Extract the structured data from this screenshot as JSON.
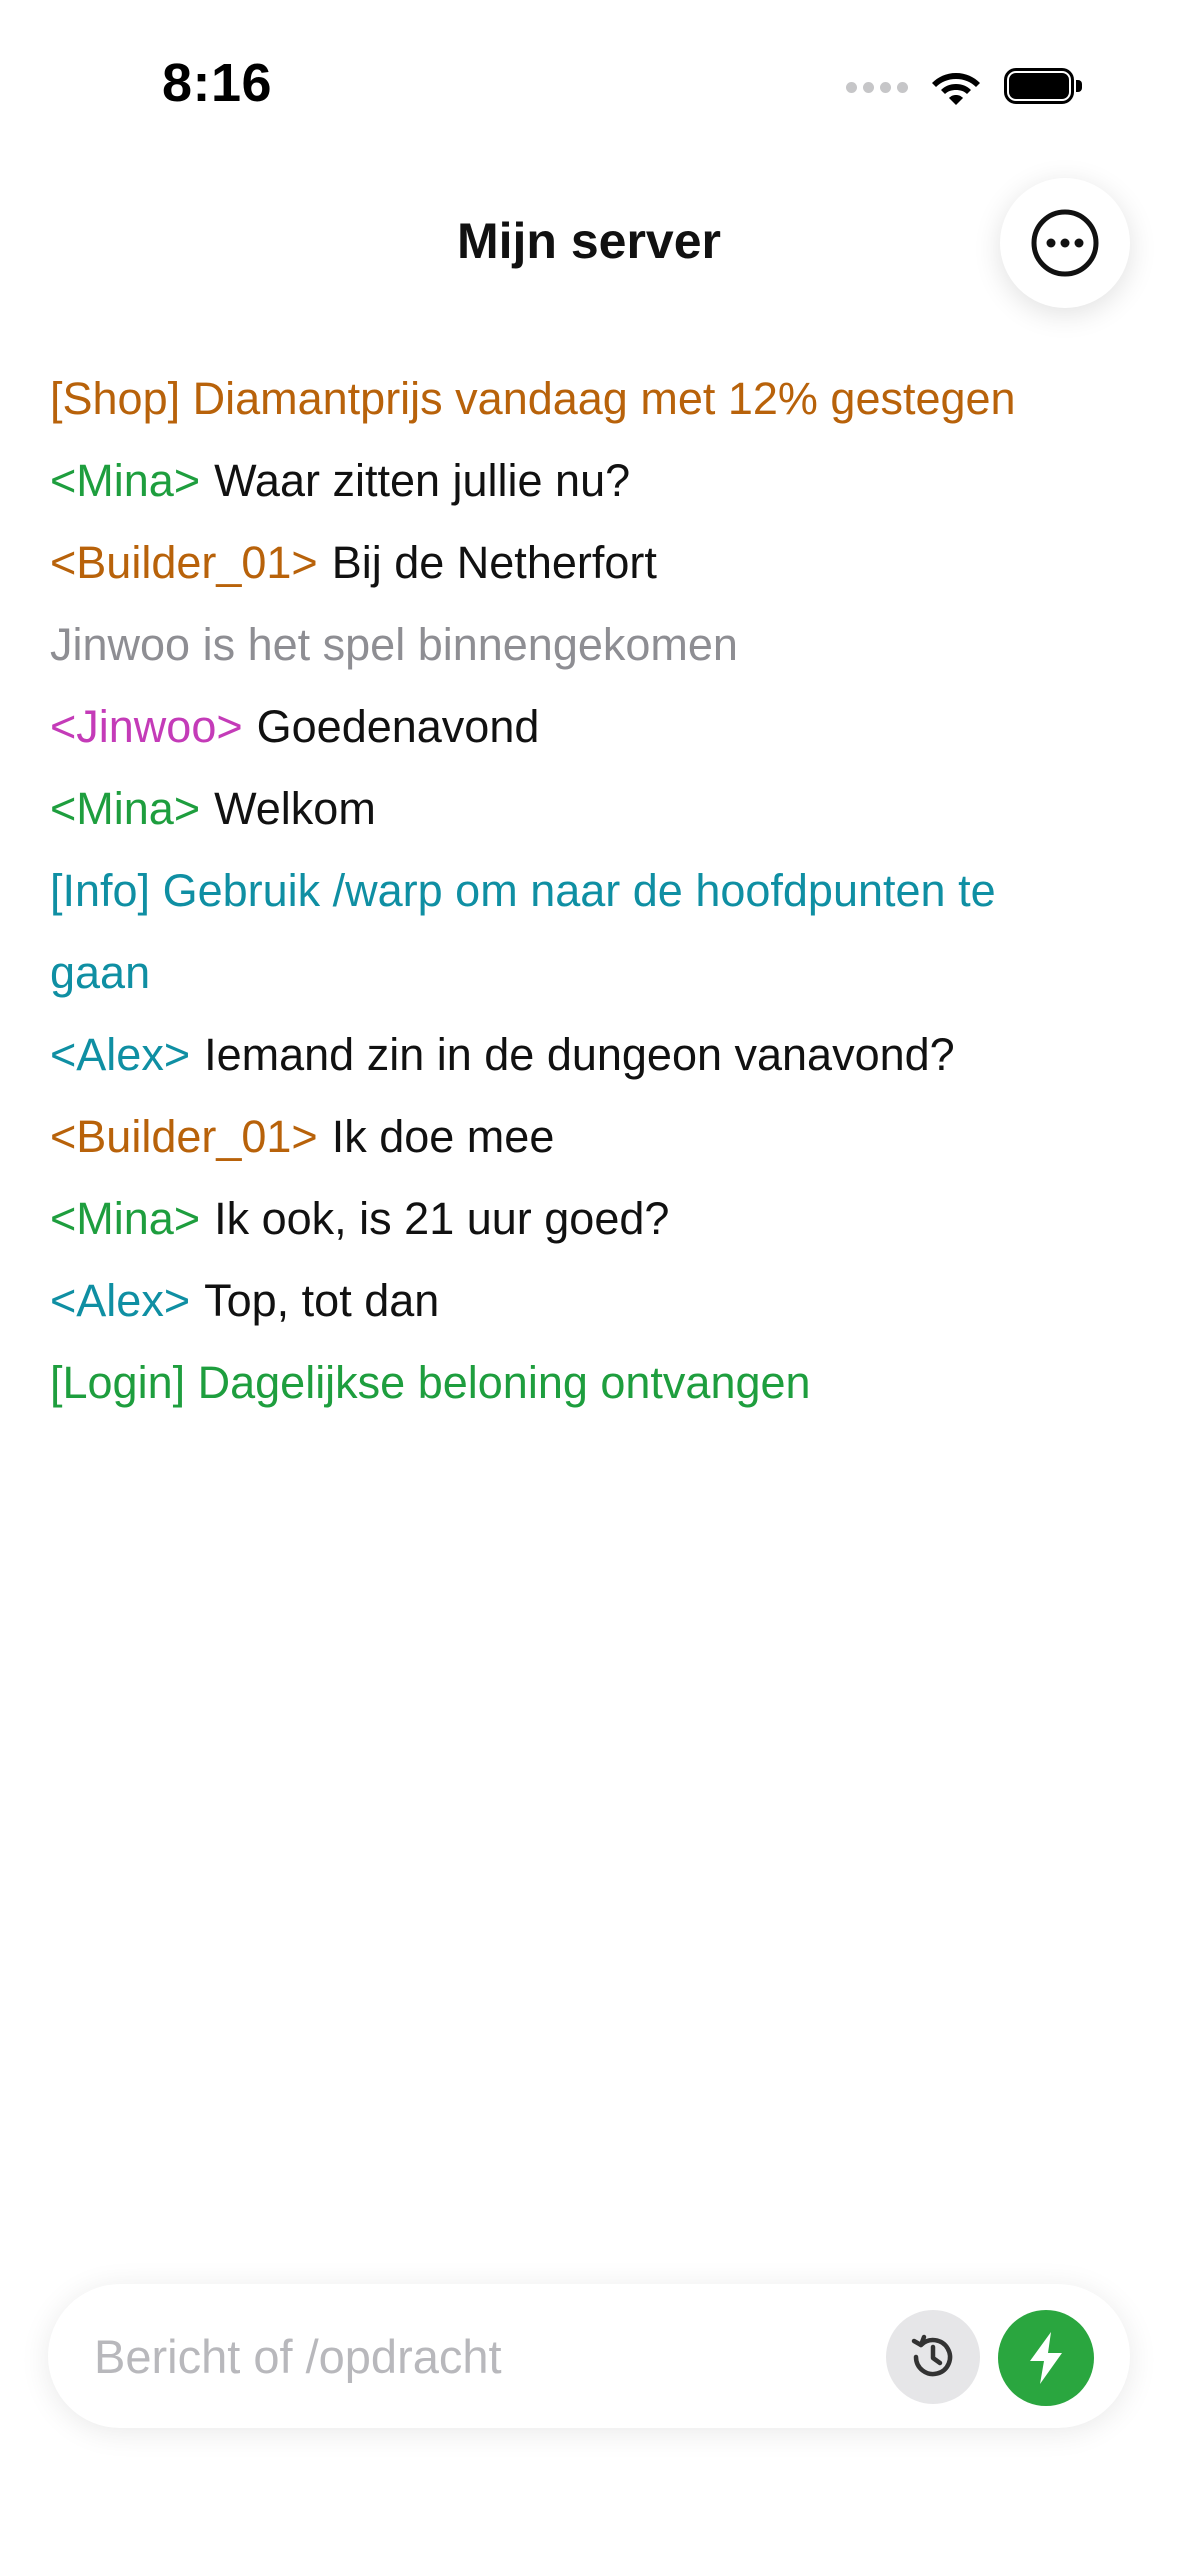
{
  "status_bar": {
    "time": "8:16",
    "icons": [
      "cellular-signal-icon",
      "wifi-icon",
      "battery-icon"
    ]
  },
  "header": {
    "title": "Mijn server",
    "more_icon": "ellipsis-circle-icon"
  },
  "chat": {
    "lines": [
      {
        "sender": "",
        "text": "[Shop] Diamantprijs vandaag met 12% gestegen",
        "sender_color": "#b8620a",
        "text_color": "#b8620a"
      },
      {
        "sender": "<Mina>",
        "text": "Waar zitten jullie nu?",
        "sender_color": "#1e9e3e",
        "text_color": "#111111"
      },
      {
        "sender": "<Builder_01>",
        "text": "Bij de Netherfort",
        "sender_color": "#b8620a",
        "text_color": "#111111"
      },
      {
        "sender": "",
        "text": "Jinwoo is het spel binnengekomen",
        "sender_color": "#8e8e93",
        "text_color": "#8e8e93"
      },
      {
        "sender": "<Jinwoo>",
        "text": "Goedenavond",
        "sender_color": "#c43bb8",
        "text_color": "#111111"
      },
      {
        "sender": "<Mina>",
        "text": "Welkom",
        "sender_color": "#1e9e3e",
        "text_color": "#111111"
      },
      {
        "sender": "",
        "text": "[Info] Gebruik /warp om naar de hoofdpunten te gaan",
        "sender_color": "#0f8fa3",
        "text_color": "#0f8fa3"
      },
      {
        "sender": "<Alex>",
        "text": "Iemand zin in de dungeon vanavond?",
        "sender_color": "#0f8fa3",
        "text_color": "#111111"
      },
      {
        "sender": "<Builder_01>",
        "text": "Ik doe mee",
        "sender_color": "#b8620a",
        "text_color": "#111111"
      },
      {
        "sender": "<Mina>",
        "text": "Ik ook, is 21 uur goed?",
        "sender_color": "#1e9e3e",
        "text_color": "#111111"
      },
      {
        "sender": "<Alex>",
        "text": "Top, tot dan",
        "sender_color": "#0f8fa3",
        "text_color": "#111111"
      },
      {
        "sender": "",
        "text": "[Login] Dagelijkse beloning ontvangen",
        "sender_color": "#1e9e3e",
        "text_color": "#1e9e3e"
      }
    ]
  },
  "composer": {
    "value": "",
    "placeholder": "Bericht of /opdracht",
    "history_icon": "history-clock-icon",
    "send_icon": "lightning-bolt-icon",
    "send_color": "#2aa63f"
  }
}
